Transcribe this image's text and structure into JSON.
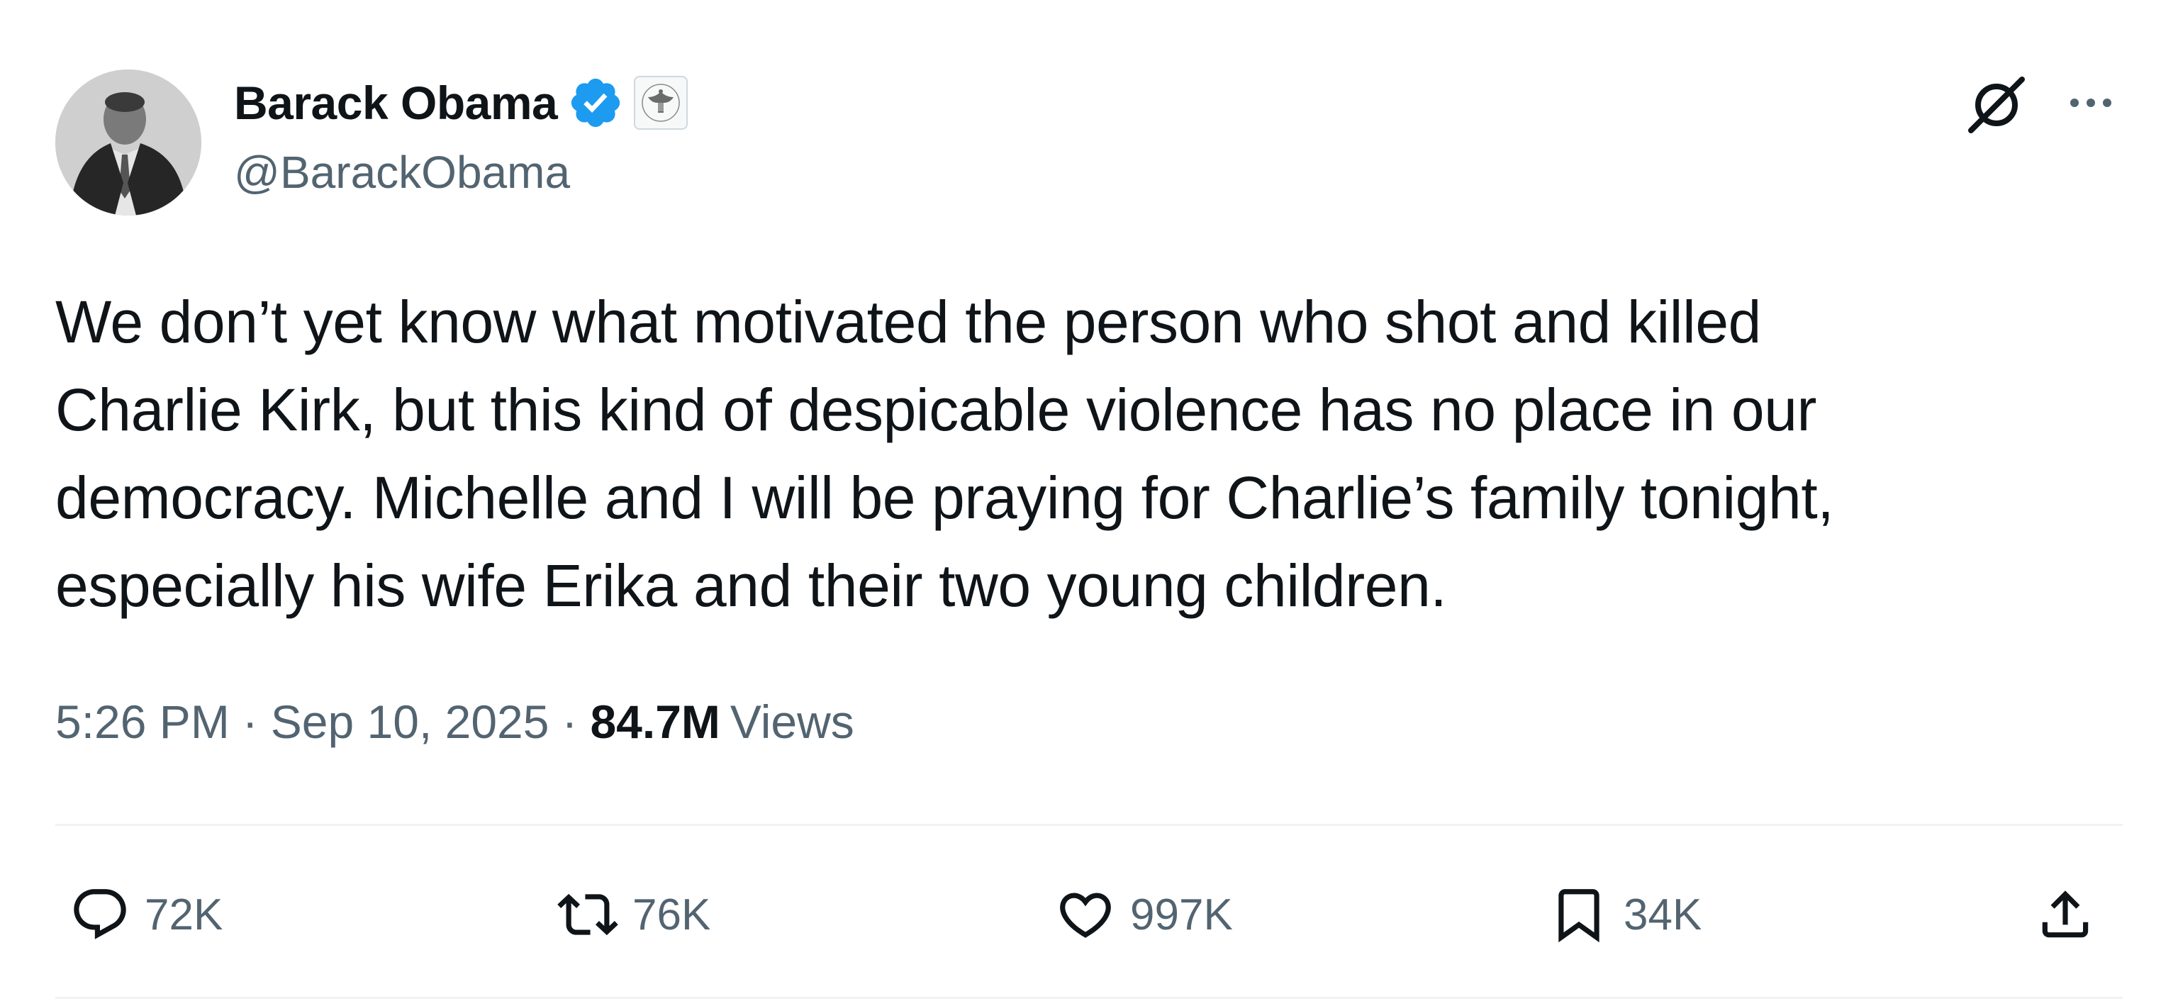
{
  "author": {
    "display_name": "Barack Obama",
    "handle": "@BarackObama",
    "verified": true,
    "affiliation_badge": "us-presidential-seal-icon",
    "avatar": "avatar"
  },
  "header_actions": {
    "grok_icon": "grok-icon",
    "more_icon": "more-options-icon"
  },
  "tweet": {
    "text_lines": [
      "We don’t yet know what motivated the person who shot and killed",
      "Charlie Kirk, but this kind of despicable violence has no place in our",
      "democracy. Michelle and I will be praying for Charlie’s family tonight,",
      "especially his wife Erika and their two young children."
    ]
  },
  "meta": {
    "time": "5:26 PM",
    "separator": "·",
    "date": "Sep 10, 2025",
    "views_count": "84.7M",
    "views_label": "Views"
  },
  "actions": {
    "replies": "72K",
    "reposts": "76K",
    "likes": "997K",
    "bookmarks": "34K"
  },
  "colors": {
    "text_primary": "#0f1419",
    "text_secondary": "#536471",
    "verified_blue": "#1d9bf0",
    "divider": "#eff3f4"
  }
}
